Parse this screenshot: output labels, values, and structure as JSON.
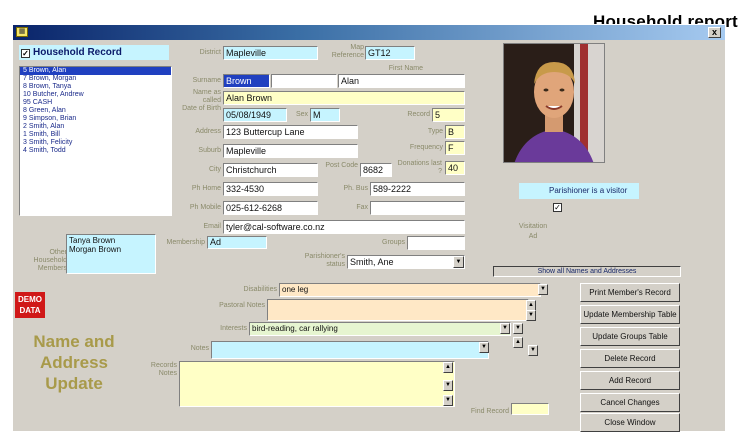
{
  "report_title": "Household report",
  "window": {
    "close": "x"
  },
  "household": {
    "checkbox_mark": "✓",
    "label": "Household Record",
    "names": [
      "5  Brown, Alan",
      "7  Brown, Morgan",
      "8  Brown, Tanya",
      "10  Butcher, Andrew",
      "95  CASH",
      "8  Green, Alan",
      "9  Simpson, Brian",
      "2  Smith, Alan",
      "1  Smith, Bill",
      "3  Smith, Felicity",
      "4  Smith, Todd"
    ],
    "selected_index": 0,
    "other_members_label": "Other Household Members",
    "other_members": [
      "Tanya Brown",
      "Morgan Brown"
    ]
  },
  "form": {
    "district_label": "District",
    "district": "Mapleville",
    "ref_label": "Map Reference",
    "ref": "GT12",
    "firstname_label": "First Name",
    "surname_label": "Surname",
    "surname": "Brown",
    "firstname": "Alan",
    "nameascalled_label": "Name as called",
    "nameascalled": "Alan Brown",
    "dob_label": "Date of Birth",
    "dob": "05/08/1949",
    "sex_label": "Sex",
    "sex": "M",
    "record_label": "Record",
    "record": "5",
    "address_label": "Address",
    "address": "123 Buttercup Lane",
    "type_label": "Type",
    "type": "B",
    "frequency_label": "Frequency",
    "frequency": "F",
    "suburb_label": "Suburb",
    "suburb": "Mapleville",
    "city_label": "City",
    "city": "Christchurch",
    "postcode_label": "Post Code",
    "postcode": "8682",
    "donations_label": "Donations last ?",
    "donations": "40",
    "phone_label": "Ph Home",
    "phone": "332-4530",
    "phbus_label": "Ph. Bus",
    "phbus": "589-2222",
    "mobile_label": "Ph Mobile",
    "mobile": "025-612-6268",
    "fax_label": "Fax",
    "fax": "",
    "email_label": "Email",
    "email": "tyler@cal-software.co.nz",
    "membership_label": "Membership",
    "membership": "Ad",
    "groups_label": "Groups",
    "groups": "",
    "parishioner_status_label": "Parishioner's status",
    "parishioner_status": "Smith, Ane",
    "visitation_label": "Visitation",
    "visitation": "Ad",
    "parishioner_visitor_label": "Parishioner is a visitor",
    "parishioner_visitor_mark": "✓",
    "disabilities_label": "Disabilities",
    "disabilities": "one leg",
    "pastoral_label": "Pastoral Notes",
    "pastoral": "",
    "interests_label": "Interests",
    "interests": "bird-reading, car rallying",
    "notes_label": "Notes",
    "notes": "",
    "records_label": "Records Notes",
    "records": "",
    "find_label": "Find Record",
    "find": ""
  },
  "buttons": {
    "show_all": "Show all Names and Addresses",
    "print": "Print Member's Record",
    "update_membership": "Update Membership Table",
    "update_groups": "Update Groups Table",
    "delete": "Delete Record",
    "add": "Add Record",
    "cancel": "Cancel Changes",
    "close": "Close Window"
  },
  "icons": {
    "dropdown": "▼",
    "scroll_up": "▲",
    "scroll_down": "▼"
  },
  "demo_badge": "DEMO DATA",
  "page_heading": "Name and Address Update",
  "colors": {
    "field_cyan": "#c6f4ff",
    "field_yellow": "#ffffc6",
    "field_peach": "#ffe8c6",
    "demo_red": "#d01818",
    "heading_olive": "#a89a4a"
  }
}
